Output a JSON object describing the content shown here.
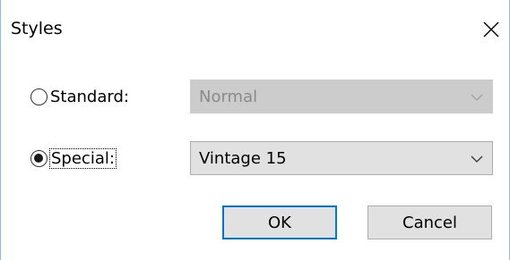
{
  "dialog": {
    "title": "Styles"
  },
  "options": {
    "standard": {
      "label": "Standard:",
      "selected": false,
      "combo_value": "Normal",
      "combo_enabled": false
    },
    "special": {
      "label": "Special:",
      "selected": true,
      "combo_value": "Vintage 15",
      "combo_enabled": true
    }
  },
  "buttons": {
    "ok_label": "OK",
    "cancel_label": "Cancel"
  },
  "colors": {
    "accent": "#0078d7",
    "disabled_bg": "#cccccc",
    "button_bg": "#e1e1e1"
  },
  "icons": {
    "close": "close-icon",
    "dropdown": "chevron-down-icon"
  }
}
